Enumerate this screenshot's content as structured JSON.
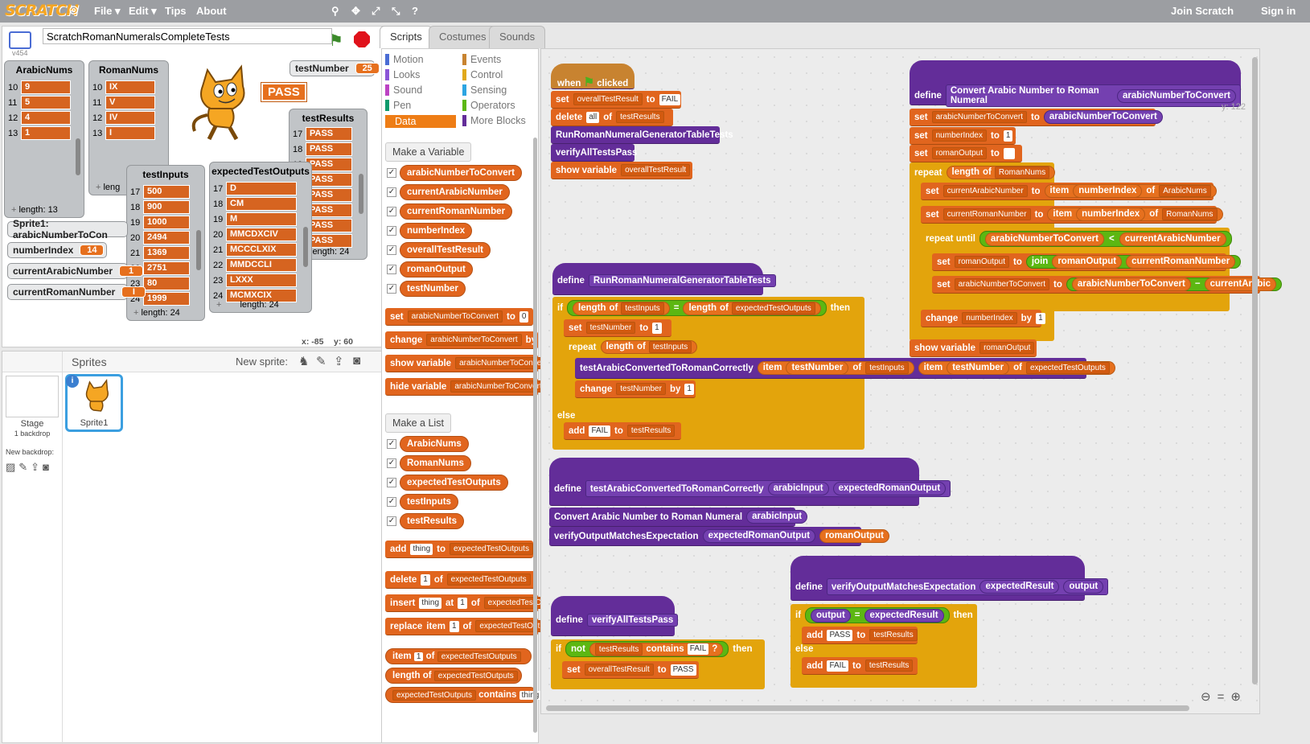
{
  "topbar": {
    "file": "File ▾",
    "edit": "Edit ▾",
    "tips": "Tips",
    "about": "About",
    "join": "Join Scratch",
    "sign": "Sign in",
    "logo": "SCRATCH"
  },
  "project": {
    "title": "ScratchRomanNumeralsCompleteTests",
    "version": "v454",
    "pass_label": "PASS",
    "coord_x": "x: -85",
    "coord_y": "y: 60"
  },
  "monitors": {
    "arabic": {
      "title": "ArabicNums",
      "rows": [
        [
          "10",
          "9"
        ],
        [
          "11",
          "5"
        ],
        [
          "12",
          "4"
        ],
        [
          "13",
          "1"
        ]
      ],
      "length": "length: 13"
    },
    "roman": {
      "title": "RomanNums",
      "rows": [
        [
          "10",
          "IX"
        ],
        [
          "11",
          "V"
        ],
        [
          "12",
          "IV"
        ],
        [
          "13",
          "I"
        ]
      ],
      "length": "leng"
    },
    "inputs": {
      "title": "testInputs",
      "rows": [
        [
          "17",
          "500"
        ],
        [
          "18",
          "900"
        ],
        [
          "19",
          "1000"
        ],
        [
          "20",
          "2494"
        ],
        [
          "21",
          "1369"
        ],
        [
          "22",
          "2751"
        ],
        [
          "23",
          "80"
        ],
        [
          "24",
          "1999"
        ]
      ],
      "length": "length: 24"
    },
    "expected": {
      "title": "expectedTestOutputs",
      "rows": [
        [
          "17",
          "D"
        ],
        [
          "18",
          "CM"
        ],
        [
          "19",
          "M"
        ],
        [
          "20",
          "MMCDXCIV"
        ],
        [
          "21",
          "MCCCLXIX"
        ],
        [
          "22",
          "MMDCCLI"
        ],
        [
          "23",
          "LXXX"
        ],
        [
          "24",
          "MCMXCIX"
        ]
      ],
      "length": "length: 24"
    },
    "results": {
      "title": "testResults",
      "rows": [
        [
          "17",
          "PASS"
        ],
        [
          "18",
          "PASS"
        ],
        [
          "19",
          "PASS"
        ],
        [
          "20",
          "PASS"
        ],
        [
          "21",
          "PASS"
        ],
        [
          "22",
          "PASS"
        ],
        [
          "23",
          "PASS"
        ],
        [
          "24",
          "PASS"
        ]
      ],
      "length": "length: 24"
    },
    "testNumber": {
      "label": "testNumber",
      "value": "25"
    },
    "sprite1": {
      "label": "Sprite1: arabicNumberToCon"
    },
    "numberIndex": {
      "label": "numberIndex",
      "value": "14"
    },
    "currentArabic": {
      "label": "currentArabicNumber",
      "value": "1"
    },
    "currentRoman": {
      "label": "currentRomanNumber",
      "value": "I"
    }
  },
  "sprites": {
    "header": "Sprites",
    "new_sprite": "New sprite:",
    "stage_label": "Stage",
    "stage_sub": "1 backdrop",
    "new_backdrop": "New backdrop:",
    "sprite1": "Sprite1"
  },
  "tabs": {
    "scripts": "Scripts",
    "costumes": "Costumes",
    "sounds": "Sounds"
  },
  "categories": [
    {
      "name": "Motion",
      "color": "#4a6cd4"
    },
    {
      "name": "Events",
      "color": "#c88330"
    },
    {
      "name": "Looks",
      "color": "#8a55d7"
    },
    {
      "name": "Control",
      "color": "#e1a91a"
    },
    {
      "name": "Sound",
      "color": "#bb42c3"
    },
    {
      "name": "Sensing",
      "color": "#2ca5e2"
    },
    {
      "name": "Pen",
      "color": "#0e9a6c"
    },
    {
      "name": "Operators",
      "color": "#5cb712"
    },
    {
      "name": "Data",
      "color": "#ee7d16"
    },
    {
      "name": "More Blocks",
      "color": "#632d99"
    }
  ],
  "palette": {
    "make_var": "Make a Variable",
    "vars": [
      "arabicNumberToConvert",
      "currentArabicNumber",
      "currentRomanNumber",
      "numberIndex",
      "overallTestResult",
      "romanOutput",
      "testNumber"
    ],
    "set": "set",
    "set_var": "arabicNumberToConvert",
    "to": "to",
    "set_val": "0",
    "change": "change",
    "change_var": "arabicNumberToConvert",
    "by": "by",
    "show_variable": "show variable",
    "hide_variable": "hide variable",
    "sv_var": "arabicNumberToConver",
    "hv_var": "arabicNumberToConvert",
    "make_list": "Make a List",
    "lists": [
      "ArabicNums",
      "RomanNums",
      "expectedTestOutputs",
      "testInputs",
      "testResults"
    ],
    "add": "add",
    "thing": "thing",
    "list": "expectedTestOutputs",
    "delete": "delete",
    "one": "1",
    "of": "of",
    "insert": "insert",
    "at": "at",
    "replace": "replace",
    "item": "item",
    "length": "length",
    "contains": "contains"
  },
  "scripts": {
    "when": "when",
    "clicked": "clicked",
    "set": "set",
    "to": "to",
    "FAIL": "FAIL",
    "PASS": "PASS",
    "delete": "delete",
    "all": "all",
    "of": "of",
    "overallTestResult": "overallTestResult",
    "testResults": "testResults",
    "runGen": "RunRomanNumeralGeneratorTableTests",
    "verifyAll": "verifyAllTestsPass",
    "show_variable": "show variable",
    "define": "define",
    "convertTitle": "Convert Arabic Number to Roman Numeral",
    "arabicNumberToConvert": "arabicNumberToConvert",
    "numberIndex": "numberIndex",
    "one": "1",
    "romanOutput": "romanOutput",
    "repeat": "repeat",
    "length": "length",
    "RomanNums": "RomanNums",
    "currentArabicNumber": "currentArabicNumber",
    "item": "item",
    "ArabicNums": "ArabicNums",
    "currentRomanNumber": "currentRomanNumber",
    "repeat_until": "repeat until",
    "lt": "<",
    "join": "join",
    "minus": "−",
    "currentArabic_trunc": "currentArabic",
    "change": "change",
    "by": "by",
    "if": "if",
    "then": "then",
    "else": "else",
    "eq": "=",
    "testInputs": "testInputs",
    "expectedTestOutputs": "expectedTestOutputs",
    "testNumber": "testNumber",
    "testArabic": "testArabicConvertedToRomanCorrectly",
    "add": "add",
    "arabicInput": "arabicInput",
    "expectedRomanOutput": "expectedRomanOutput",
    "verifyOutput": "verifyOutputMatchesExpectation",
    "expectedResult": "expectedResult",
    "output": "output",
    "not": "not",
    "contains": "contains",
    "q": "?",
    "y122": "y: 122"
  }
}
